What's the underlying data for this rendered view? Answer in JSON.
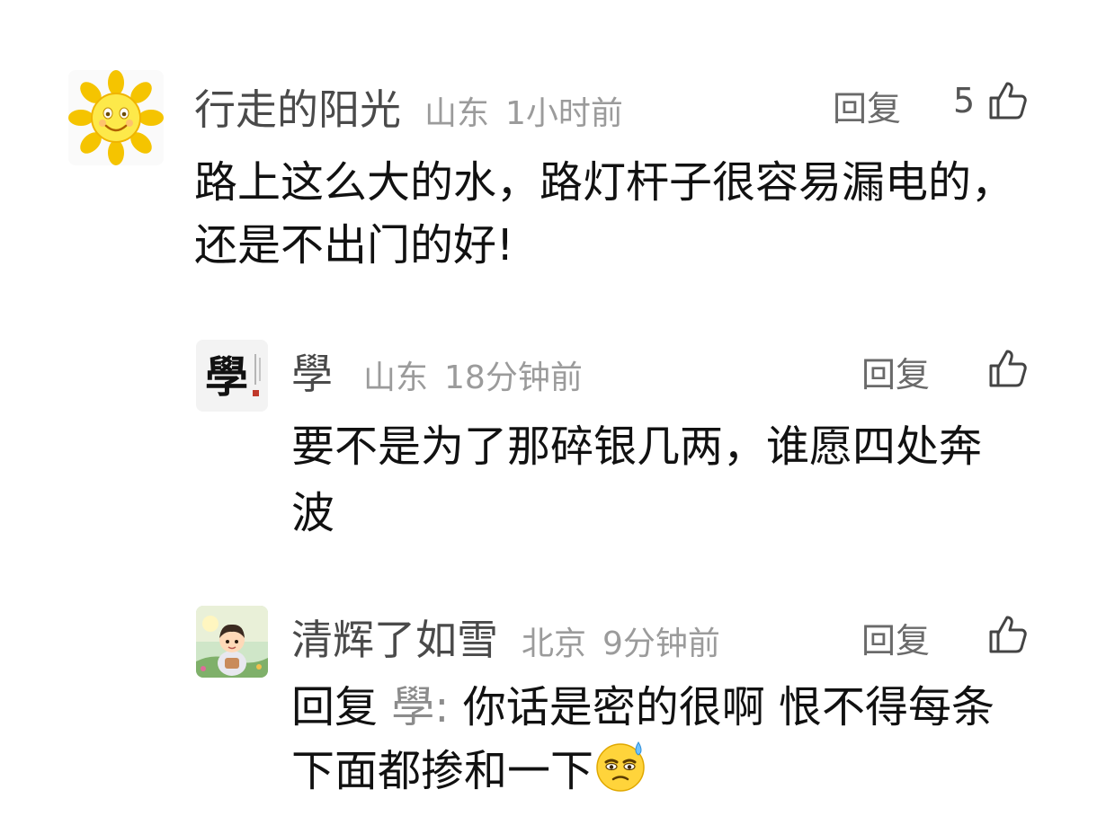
{
  "comments": [
    {
      "username": "行走的阳光",
      "location": "山东",
      "time": "1小时前",
      "reply_label": "回复",
      "like_count": "5",
      "text": "路上这么大的水，路灯杆子很容易漏电的，还是不出门的好!",
      "avatar_icon": "sun-avatar-icon"
    },
    {
      "username": "學",
      "location": "山东",
      "time": "18分钟前",
      "reply_label": "回复",
      "like_count": "",
      "text": "要不是为了那碎银几两，谁愿四处奔波",
      "avatar_icon": "calligraphy-avatar-icon"
    },
    {
      "username": "清辉了如雪",
      "location": "北京",
      "time": "9分钟前",
      "reply_label": "回复",
      "like_count": "",
      "reply_prefix_label": "回复",
      "reply_prefix_user": "學:",
      "text": "你话是密的很啊 恨不得每条下面都掺和一下",
      "emoji": "sweat-smile-emoji",
      "avatar_icon": "boy-portrait-avatar-icon"
    }
  ]
}
